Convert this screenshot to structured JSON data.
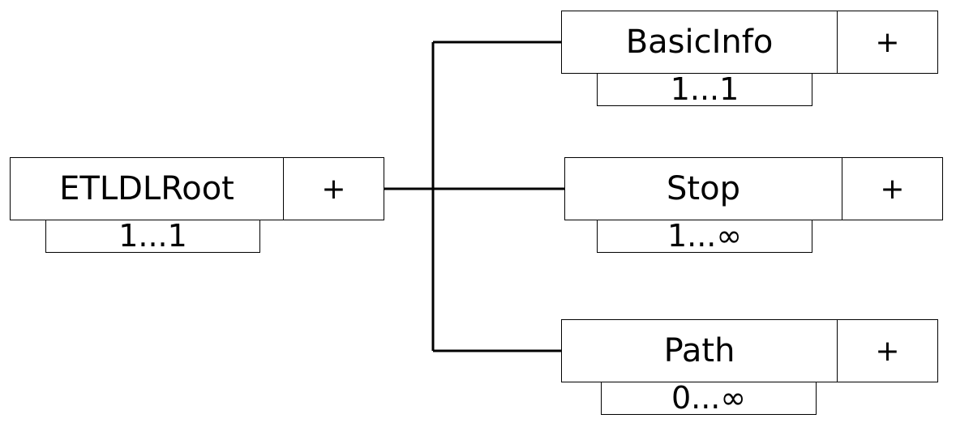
{
  "diagram": {
    "root": {
      "name": "ETLDLRoot",
      "expand_label": "+",
      "cardinality": "1...1"
    },
    "children": [
      {
        "name": "BasicInfo",
        "expand_label": "+",
        "cardinality": "1...1"
      },
      {
        "name": "Stop",
        "expand_label": "+",
        "cardinality": "1...∞"
      },
      {
        "name": "Path",
        "expand_label": "+",
        "cardinality": "0...∞"
      }
    ]
  }
}
